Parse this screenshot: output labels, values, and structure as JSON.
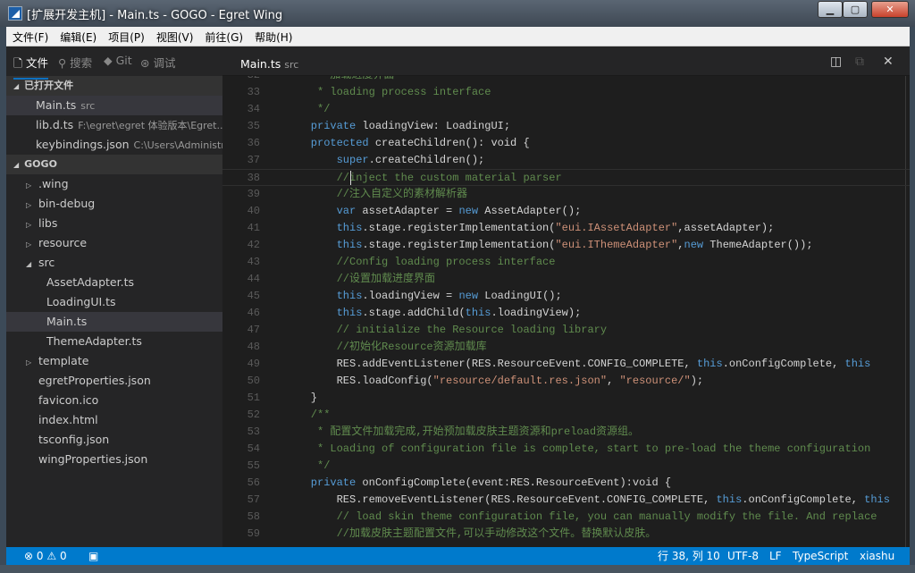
{
  "window": {
    "title": "[扩展开发主机] - Main.ts - GOGO - Egret Wing",
    "min": "▁",
    "max": "▢",
    "close": "✕"
  },
  "menu": [
    "文件(F)",
    "编辑(E)",
    "项目(P)",
    "视图(V)",
    "前往(G)",
    "帮助(H)"
  ],
  "sidebar": {
    "tabs": [
      {
        "icon": "🗋",
        "label": "文件"
      },
      {
        "icon": "⚲",
        "label": "搜索"
      },
      {
        "icon": "◆",
        "label": "Git"
      },
      {
        "icon": "⊛",
        "label": "调试"
      }
    ],
    "open_header": "已打开文件",
    "open_files": [
      {
        "name": "Main.ts",
        "hint": "src"
      },
      {
        "name": "lib.d.ts",
        "hint": "F:\\egret\\egret 体验版本\\Egret..."
      },
      {
        "name": "keybindings.json",
        "hint": "C:\\Users\\Administr..."
      }
    ],
    "project_header": "GOGO",
    "tree": [
      {
        "name": ".wing",
        "twisty": "▷",
        "depth": 0
      },
      {
        "name": "bin-debug",
        "twisty": "▷",
        "depth": 0
      },
      {
        "name": "libs",
        "twisty": "▷",
        "depth": 0
      },
      {
        "name": "resource",
        "twisty": "▷",
        "depth": 0
      },
      {
        "name": "src",
        "twisty": "◢",
        "depth": 0
      },
      {
        "name": "AssetAdapter.ts",
        "twisty": "",
        "depth": 1
      },
      {
        "name": "LoadingUI.ts",
        "twisty": "",
        "depth": 1
      },
      {
        "name": "Main.ts",
        "twisty": "",
        "depth": 1,
        "selected": true
      },
      {
        "name": "ThemeAdapter.ts",
        "twisty": "",
        "depth": 1
      },
      {
        "name": "template",
        "twisty": "▷",
        "depth": 0
      },
      {
        "name": "egretProperties.json",
        "twisty": "",
        "depth": 0
      },
      {
        "name": "favicon.ico",
        "twisty": "",
        "depth": 0
      },
      {
        "name": "index.html",
        "twisty": "",
        "depth": 0
      },
      {
        "name": "tsconfig.json",
        "twisty": "",
        "depth": 0
      },
      {
        "name": "wingProperties.json",
        "twisty": "",
        "depth": 0
      }
    ]
  },
  "editor": {
    "tab": {
      "name": "Main.ts",
      "hint": "src"
    },
    "current_line": 38,
    "lines": [
      [
        32,
        [
          [
            "c",
            "     * 加载进度界面"
          ]
        ]
      ],
      [
        33,
        [
          [
            "c",
            "     * loading process interface"
          ]
        ]
      ],
      [
        34,
        [
          [
            "c",
            "     */"
          ]
        ]
      ],
      [
        35,
        [
          [
            "k",
            "    private"
          ],
          [
            "n",
            " loadingView: LoadingUI;"
          ]
        ]
      ],
      [
        36,
        [
          [
            "k",
            "    protected"
          ],
          [
            "n",
            " createChildren(): void {"
          ]
        ]
      ],
      [
        37,
        [
          [
            "k",
            "        super"
          ],
          [
            "n",
            ".createChildren();"
          ]
        ]
      ],
      [
        38,
        [
          [
            "c",
            "        //inject the custom material parser"
          ]
        ]
      ],
      [
        39,
        [
          [
            "c",
            "        //注入自定义的素材解析器"
          ]
        ]
      ],
      [
        40,
        [
          [
            "k",
            "        var"
          ],
          [
            "n",
            " assetAdapter = "
          ],
          [
            "k",
            "new"
          ],
          [
            "n",
            " AssetAdapter();"
          ]
        ]
      ],
      [
        41,
        [
          [
            "k",
            "        this"
          ],
          [
            "n",
            ".stage.registerImplementation("
          ],
          [
            "s",
            "\"eui.IAssetAdapter\""
          ],
          [
            "n",
            ",assetAdapter);"
          ]
        ]
      ],
      [
        42,
        [
          [
            "k",
            "        this"
          ],
          [
            "n",
            ".stage.registerImplementation("
          ],
          [
            "s",
            "\"eui.IThemeAdapter\""
          ],
          [
            "n",
            ","
          ],
          [
            "k",
            "new"
          ],
          [
            "n",
            " ThemeAdapter());"
          ]
        ]
      ],
      [
        43,
        [
          [
            "c",
            "        //Config loading process interface"
          ]
        ]
      ],
      [
        44,
        [
          [
            "c",
            "        //设置加载进度界面"
          ]
        ]
      ],
      [
        45,
        [
          [
            "k",
            "        this"
          ],
          [
            "n",
            ".loadingView = "
          ],
          [
            "k",
            "new"
          ],
          [
            "n",
            " LoadingUI();"
          ]
        ]
      ],
      [
        46,
        [
          [
            "k",
            "        this"
          ],
          [
            "n",
            ".stage.addChild("
          ],
          [
            "k",
            "this"
          ],
          [
            "n",
            ".loadingView);"
          ]
        ]
      ],
      [
        47,
        [
          [
            "c",
            "        // initialize the Resource loading library"
          ]
        ]
      ],
      [
        48,
        [
          [
            "c",
            "        //初始化Resource资源加载库"
          ]
        ]
      ],
      [
        49,
        [
          [
            "n",
            "        RES.addEventListener(RES.ResourceEvent.CONFIG_COMPLETE, "
          ],
          [
            "k",
            "this"
          ],
          [
            "n",
            ".onConfigComplete, "
          ],
          [
            "k",
            "this"
          ]
        ]
      ],
      [
        50,
        [
          [
            "n",
            "        RES.loadConfig("
          ],
          [
            "s",
            "\"resource/default.res.json\""
          ],
          [
            "n",
            ", "
          ],
          [
            "s",
            "\"resource/\""
          ],
          [
            "n",
            ");"
          ]
        ]
      ],
      [
        51,
        [
          [
            "n",
            "    }"
          ]
        ]
      ],
      [
        52,
        [
          [
            "c",
            "    /**"
          ]
        ]
      ],
      [
        53,
        [
          [
            "c",
            "     * 配置文件加载完成,开始预加载皮肤主题资源和preload资源组。"
          ]
        ]
      ],
      [
        54,
        [
          [
            "c",
            "     * Loading of configuration file is complete, start to pre-load the theme configuration"
          ]
        ]
      ],
      [
        55,
        [
          [
            "c",
            "     */"
          ]
        ]
      ],
      [
        56,
        [
          [
            "k",
            "    private"
          ],
          [
            "n",
            " onConfigComplete(event:RES.ResourceEvent):void {"
          ]
        ]
      ],
      [
        57,
        [
          [
            "n",
            "        RES.removeEventListener(RES.ResourceEvent.CONFIG_COMPLETE, "
          ],
          [
            "k",
            "this"
          ],
          [
            "n",
            ".onConfigComplete, "
          ],
          [
            "k",
            "this"
          ]
        ]
      ],
      [
        58,
        [
          [
            "c",
            "        // load skin theme configuration file, you can manually modify the file. And replace"
          ]
        ]
      ],
      [
        59,
        [
          [
            "c",
            "        //加载皮肤主题配置文件,可以手动修改这个文件。替换默认皮肤。"
          ]
        ]
      ]
    ]
  },
  "status": {
    "errors": "0",
    "warnings": "0",
    "position": "行 38, 列 10",
    "encoding": "UTF-8",
    "eol": "LF",
    "language": "TypeScript",
    "user": "xiashu"
  },
  "colors": {
    "statusbar": "#007acc",
    "editor_bg": "#1e1e1e",
    "sidebar_bg": "#252526",
    "keyword": "#569cd6",
    "comment": "#608b4e",
    "string": "#ce9178"
  }
}
